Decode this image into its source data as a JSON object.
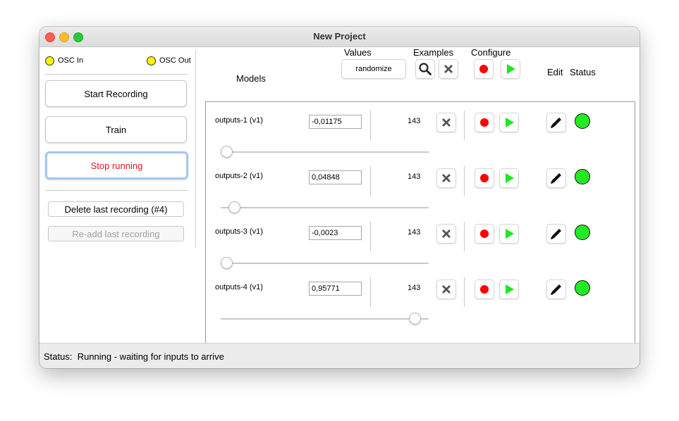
{
  "window": {
    "title": "New Project"
  },
  "osc": {
    "in_label": "OSC In",
    "out_label": "OSC Out",
    "indicator_color": "#f8f400"
  },
  "left": {
    "start_recording": "Start Recording",
    "train": "Train",
    "stop_running": "Stop running",
    "delete_last": "Delete last recording (#4)",
    "readd_last": "Re-add last recording"
  },
  "headers": {
    "models": "Models",
    "values": "Values",
    "examples": "Examples",
    "configure": "Configure",
    "edit": "Edit",
    "status": "Status",
    "randomize": "randomize"
  },
  "models": [
    {
      "name": "outputs-1 (v1)",
      "value": "-0,01175",
      "examples": "143",
      "slider_fraction": 0.0
    },
    {
      "name": "outputs-2 (v1)",
      "value": "0,04848",
      "examples": "143",
      "slider_fraction": 0.04
    },
    {
      "name": "outputs-3 (v1)",
      "value": "-0,0023",
      "examples": "143",
      "slider_fraction": 0.0
    },
    {
      "name": "outputs-4 (v1)",
      "value": "0,95771",
      "examples": "143",
      "slider_fraction": 0.955
    }
  ],
  "colors": {
    "status_ok": "#24ea24",
    "record": "#ff0000",
    "play": "#1ee81e",
    "stop_text": "#e0151a"
  },
  "statusbar": {
    "label": "Status:",
    "text": "Running - waiting for inputs to arrive"
  }
}
